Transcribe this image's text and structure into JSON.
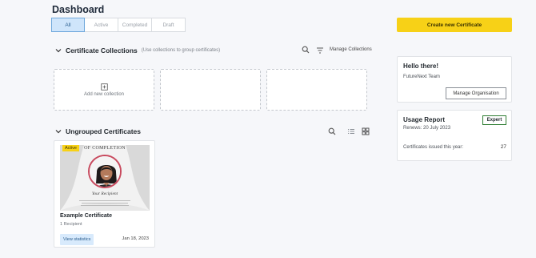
{
  "header": {
    "title": "Dashboard",
    "create_button": "Create new Certificate"
  },
  "tabs": [
    {
      "label": "All",
      "active": true
    },
    {
      "label": "Active",
      "active": false
    },
    {
      "label": "Completed",
      "active": false
    },
    {
      "label": "Draft",
      "active": false
    }
  ],
  "collections": {
    "title": "Certificate Collections",
    "subtitle": "(Use collections to group certificates)",
    "manage_label": "Manage Collections",
    "add_label": "Add new collection"
  },
  "ungrouped": {
    "title": "Ungrouped Certificates",
    "certificate": {
      "status": "Active",
      "heading": "OF COMPLETION",
      "recipient_placeholder": "Your Recipient",
      "title": "Example Certificate",
      "recipients": "1 Recipient",
      "stats_button": "View statistics",
      "date": "Jan 18, 2023"
    }
  },
  "hello_panel": {
    "title": "Hello there!",
    "team": "FutureNext Team",
    "button": "Manage Organisation"
  },
  "usage_panel": {
    "title": "Usage Report",
    "plan": "Expert",
    "renews": "Renews: 20 July 2023",
    "issued_label": "Certificates issued this year:",
    "issued_count": "27"
  },
  "colors": {
    "accent": "#f7d117",
    "active_tab": "#cfe5fb",
    "link_blue": "#d8eafc"
  },
  "icons": [
    "search-icon",
    "filter-icon",
    "list-view-icon",
    "grid-view-icon",
    "chevron-down-icon",
    "plus-square-icon"
  ]
}
